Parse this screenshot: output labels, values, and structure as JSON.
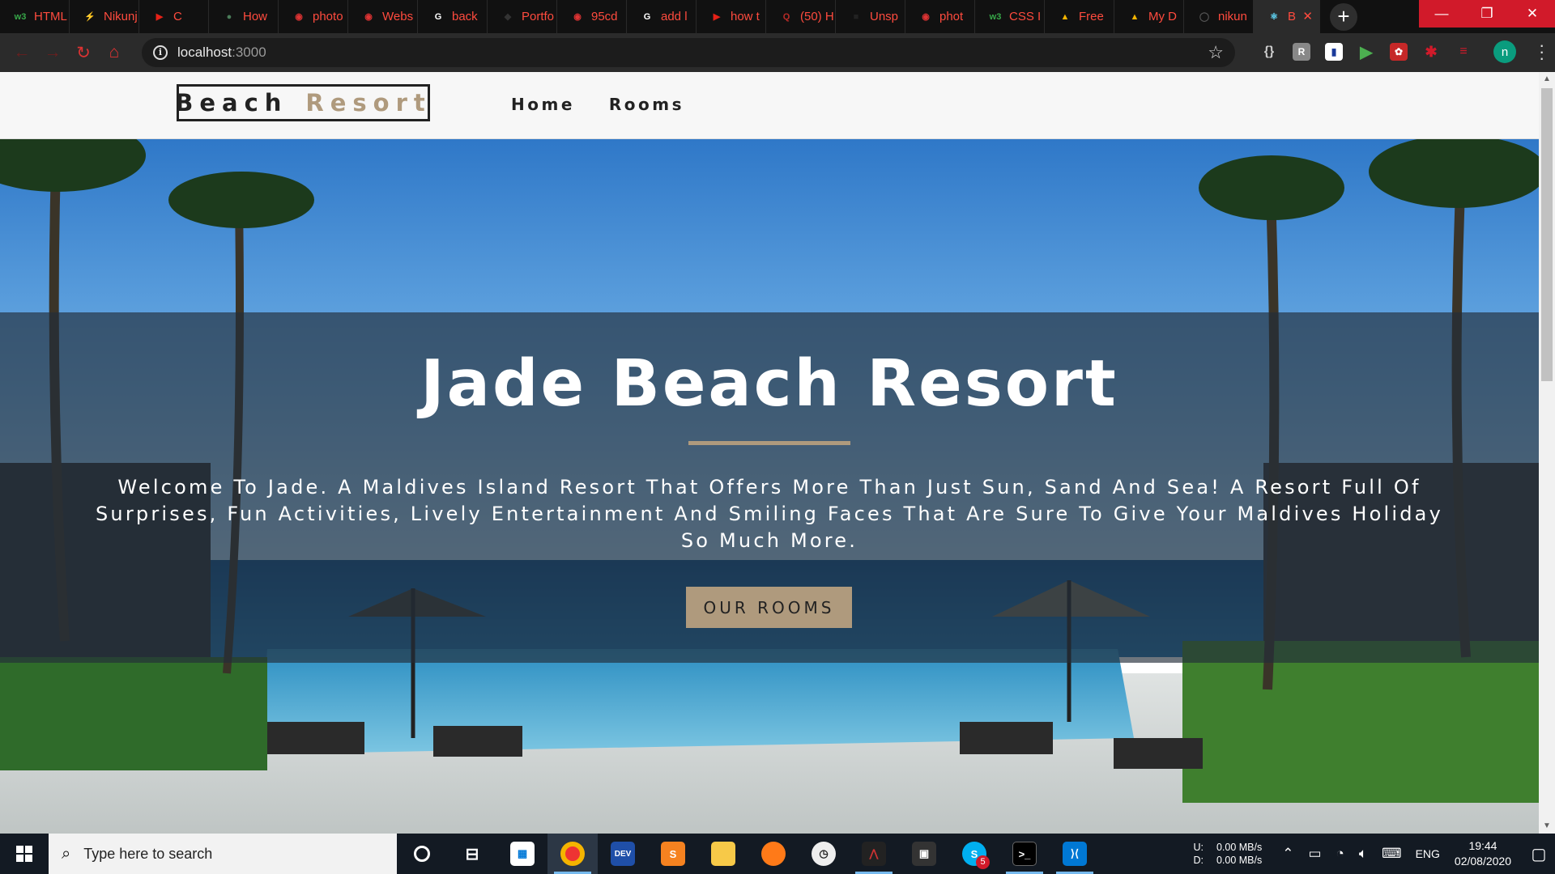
{
  "browser": {
    "tabs": [
      {
        "label": "HTML",
        "favicon": "w3schools-icon",
        "color": "#37a849",
        "glyph": "w3"
      },
      {
        "label": "Nikunj",
        "favicon": "lightning-icon",
        "color": "#f2c200",
        "glyph": "⚡"
      },
      {
        "label": "C",
        "favicon": "youtube-icon",
        "color": "#e62117",
        "glyph": "▶"
      },
      {
        "label": "How",
        "favicon": "globe-icon",
        "color": "#4a7c59",
        "glyph": "●"
      },
      {
        "label": "photo",
        "favicon": "firefox-red-icon",
        "color": "#d33",
        "glyph": "◉"
      },
      {
        "label": "Webs",
        "favicon": "firefox-red-icon",
        "color": "#d33",
        "glyph": "◉"
      },
      {
        "label": "back",
        "favicon": "google-icon",
        "color": "#ffffff",
        "glyph": "G"
      },
      {
        "label": "Portfo",
        "favicon": "github-dark-icon",
        "color": "#333333",
        "glyph": "◆"
      },
      {
        "label": "95cd",
        "favicon": "firefox-red-icon",
        "color": "#d33",
        "glyph": "◉"
      },
      {
        "label": "add l",
        "favicon": "google-icon",
        "color": "#ffffff",
        "glyph": "G"
      },
      {
        "label": "how t",
        "favicon": "youtube-icon",
        "color": "#e62117",
        "glyph": "▶"
      },
      {
        "label": "(50) H",
        "favicon": "quora-icon",
        "color": "#b92b27",
        "glyph": "Q"
      },
      {
        "label": "Unsp",
        "favicon": "unsplash-icon",
        "color": "#222222",
        "glyph": "■"
      },
      {
        "label": "phot",
        "favicon": "firefox-red-icon",
        "color": "#d33",
        "glyph": "◉"
      },
      {
        "label": "CSS I",
        "favicon": "w3schools-icon",
        "color": "#37a849",
        "glyph": "w3"
      },
      {
        "label": "Free",
        "favicon": "google-drive-icon",
        "color": "#f4b400",
        "glyph": "▲"
      },
      {
        "label": "My D",
        "favicon": "google-drive-icon",
        "color": "#f4b400",
        "glyph": "▲"
      },
      {
        "label": "nikun",
        "favicon": "github-icon",
        "color": "#555555",
        "glyph": "◯"
      },
      {
        "label": "B",
        "favicon": "react-icon",
        "color": "#61dafb",
        "glyph": "⚛",
        "active": true
      }
    ],
    "new_tab": "+",
    "window_controls": {
      "minimize": "—",
      "restore": "❐",
      "close": "✕"
    },
    "address": {
      "host": "localhost",
      "port": ":3000"
    },
    "profile_initial": "n"
  },
  "site": {
    "logo": {
      "word1": "Beach",
      "word2": "Resort"
    },
    "nav": [
      "Home",
      "Rooms"
    ],
    "hero": {
      "title": "Jade Beach Resort",
      "text": "Welcome To Jade. A Maldives Island Resort That Offers More Than Just Sun, Sand And Sea! A Resort Full Of Surprises, Fun Activities, Lively Entertainment And Smiling Faces That Are Sure To Give Your Maldives Holiday So Much More.",
      "button": "OUR ROOMS"
    },
    "colors": {
      "accent": "#af9a7d",
      "banner": "rgba(35,45,58,0.66)"
    }
  },
  "taskbar": {
    "search_placeholder": "Type here to search",
    "network": {
      "up_label": "U:",
      "down_label": "D:",
      "up": "0.00 MB/s",
      "down": "0.00 MB/s"
    },
    "language": "ENG",
    "time": "19:44",
    "date": "02/08/2020",
    "skype_badge": "5"
  }
}
